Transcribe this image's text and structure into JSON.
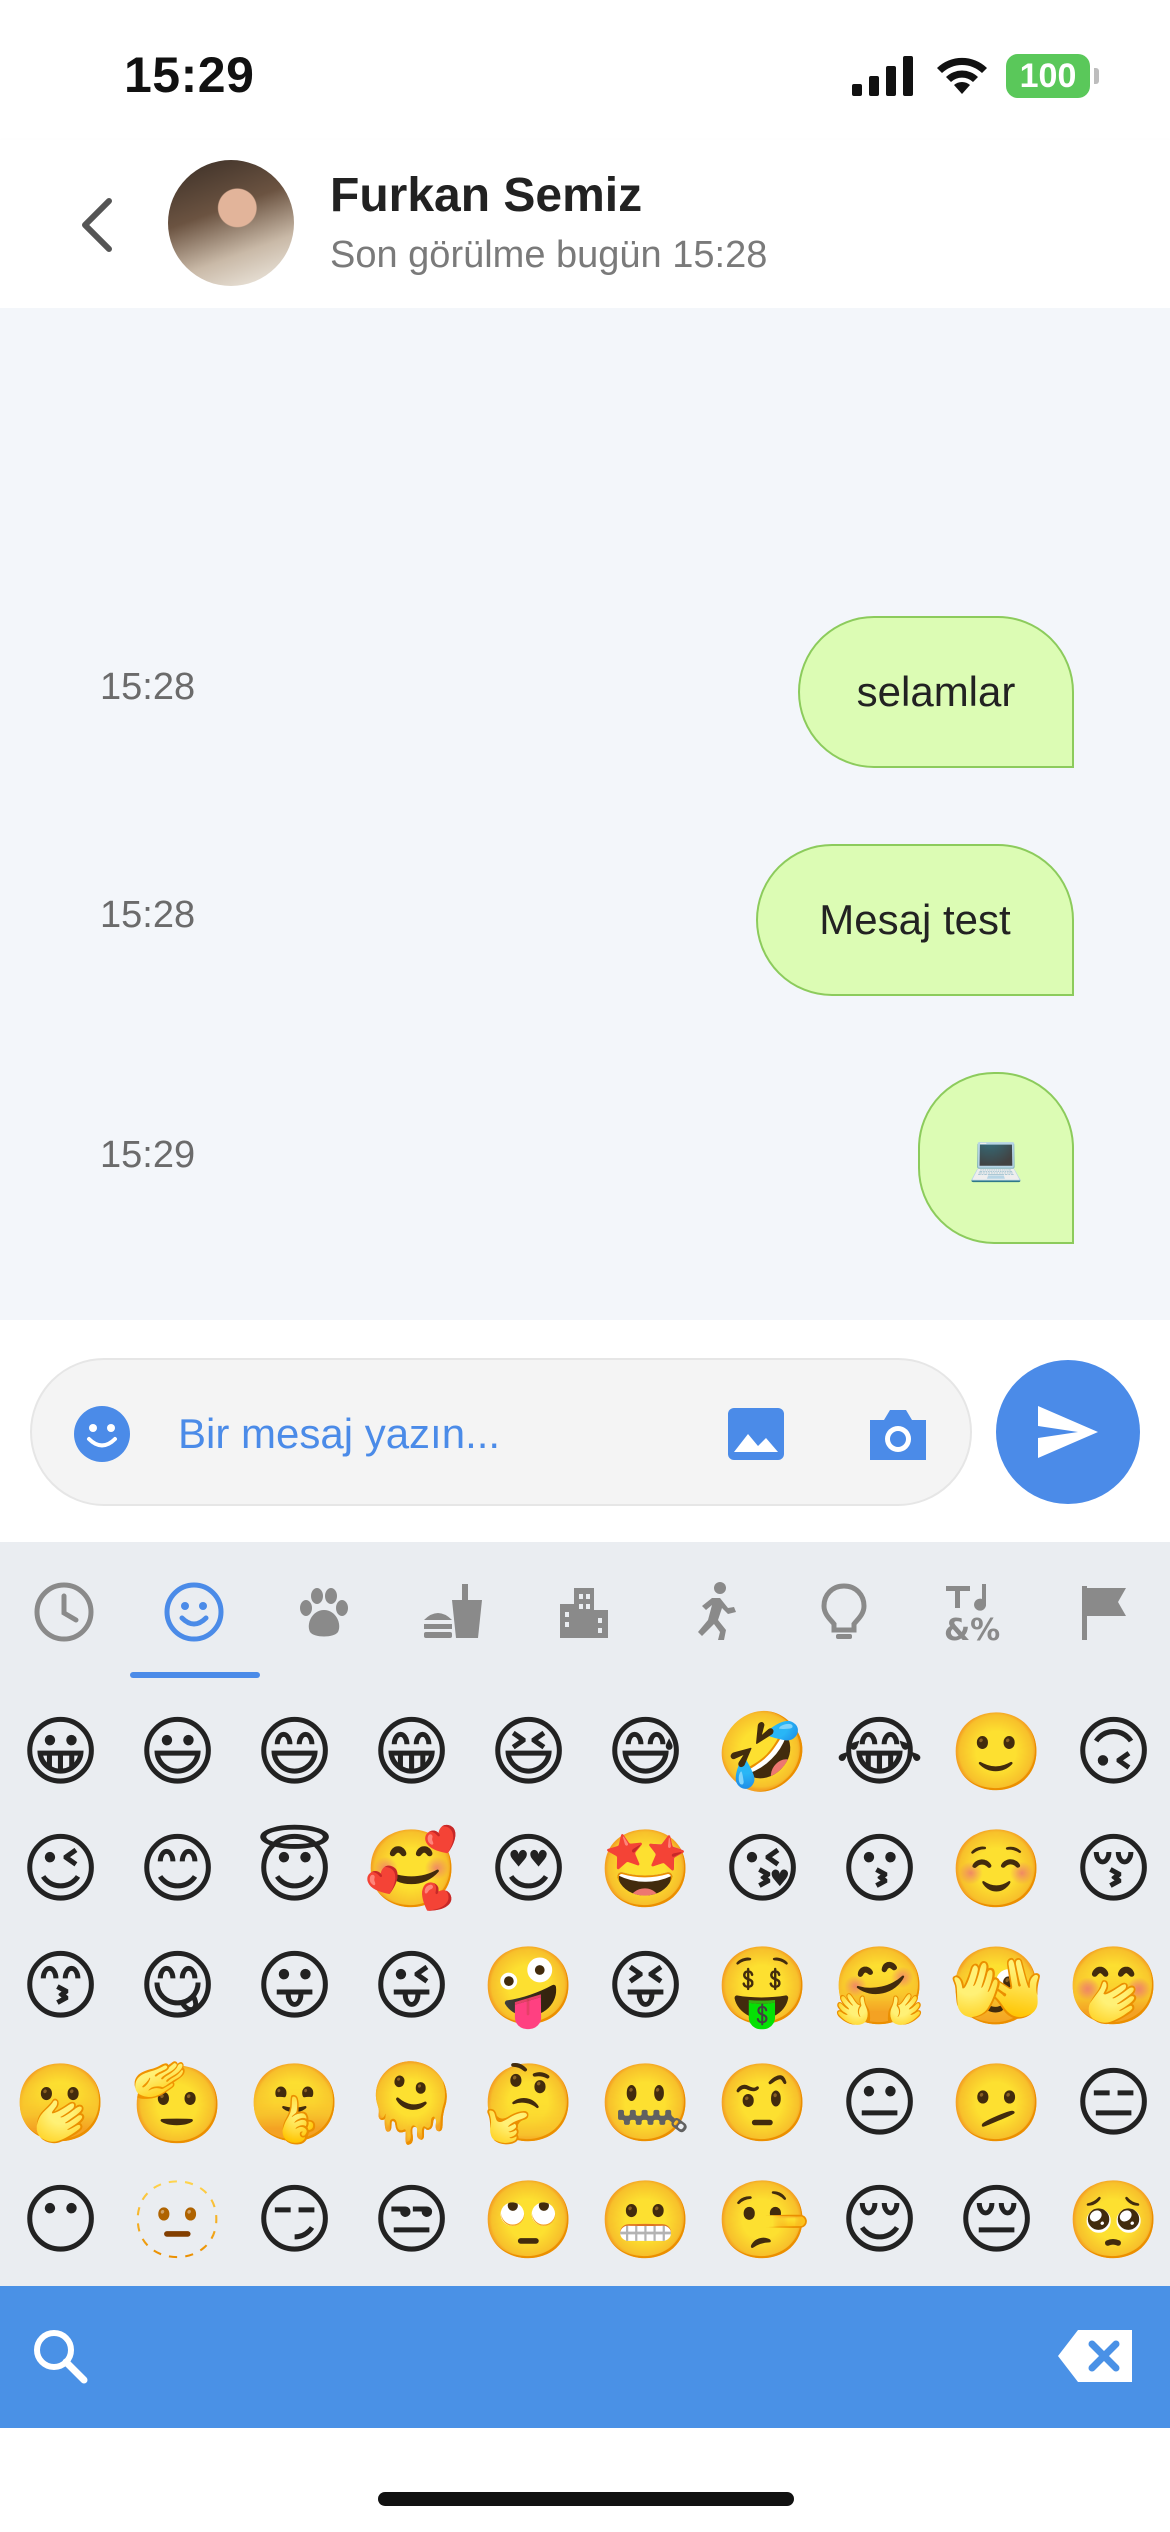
{
  "status_bar": {
    "time": "15:29",
    "battery": "100"
  },
  "header": {
    "name": "Furkan Semiz",
    "last_seen": "Son görülme bugün 15:28"
  },
  "messages": [
    {
      "time": "15:28",
      "text": "selamlar"
    },
    {
      "time": "15:28",
      "text": "Mesaj test"
    },
    {
      "time": "15:29",
      "text": "💻"
    }
  ],
  "composer": {
    "placeholder": "Bir mesaj yazın..."
  },
  "emoji_picker": {
    "categories": [
      "recent",
      "smileys",
      "animals",
      "food",
      "travel",
      "activities",
      "objects",
      "symbols",
      "flags"
    ],
    "selected_category": "smileys",
    "rows": [
      [
        "😀",
        "😃",
        "😄",
        "😁",
        "😆",
        "😅",
        "🤣",
        "😂",
        "🙂",
        "🙃"
      ],
      [
        "😉",
        "😊",
        "😇",
        "🥰",
        "😍",
        "🤩",
        "😘",
        "😗",
        "☺️",
        "😚"
      ],
      [
        "😙",
        "😋",
        "😛",
        "😜",
        "🤪",
        "😝",
        "🤑",
        "🤗",
        "🫣",
        "🤭"
      ],
      [
        "🫢",
        "🫡",
        "🤫",
        "🫠",
        "🤔",
        "🤐",
        "🤨",
        "😐",
        "🫤",
        "😑"
      ],
      [
        "😶",
        "🫥",
        "😏",
        "😒",
        "🙄",
        "😬",
        "🤥",
        "😌",
        "😔",
        "🥺"
      ]
    ]
  },
  "colors": {
    "accent": "#4b8be8",
    "bubble_fill": "#dcfcb4",
    "bubble_border": "#8ccb5c",
    "chat_bg": "#f3f6fa"
  }
}
